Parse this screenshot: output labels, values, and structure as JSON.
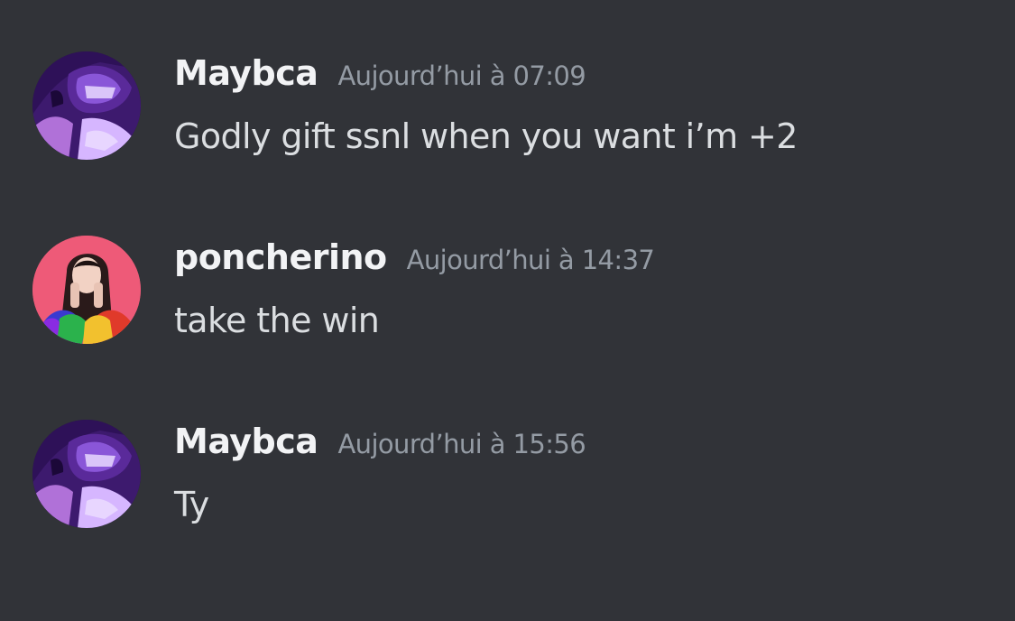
{
  "theme": {
    "background": "#313338",
    "username_color": "#f2f3f5",
    "timestamp_color": "#949ba4",
    "text_color": "#dbdee1"
  },
  "messages": [
    {
      "author": "Maybca",
      "timestamp": "Aujourd’hui à 07:09",
      "text": "Godly gift ssnl when you want i’m +2",
      "avatar_icon": "purple-armored-character-avatar"
    },
    {
      "author": "poncherino",
      "timestamp": "Aujourd’hui à 14:37",
      "text": "take the win",
      "avatar_icon": "woman-pink-background-avatar"
    },
    {
      "author": "Maybca",
      "timestamp": "Aujourd’hui à 15:56",
      "text": "Ty",
      "avatar_icon": "purple-armored-character-avatar"
    }
  ]
}
